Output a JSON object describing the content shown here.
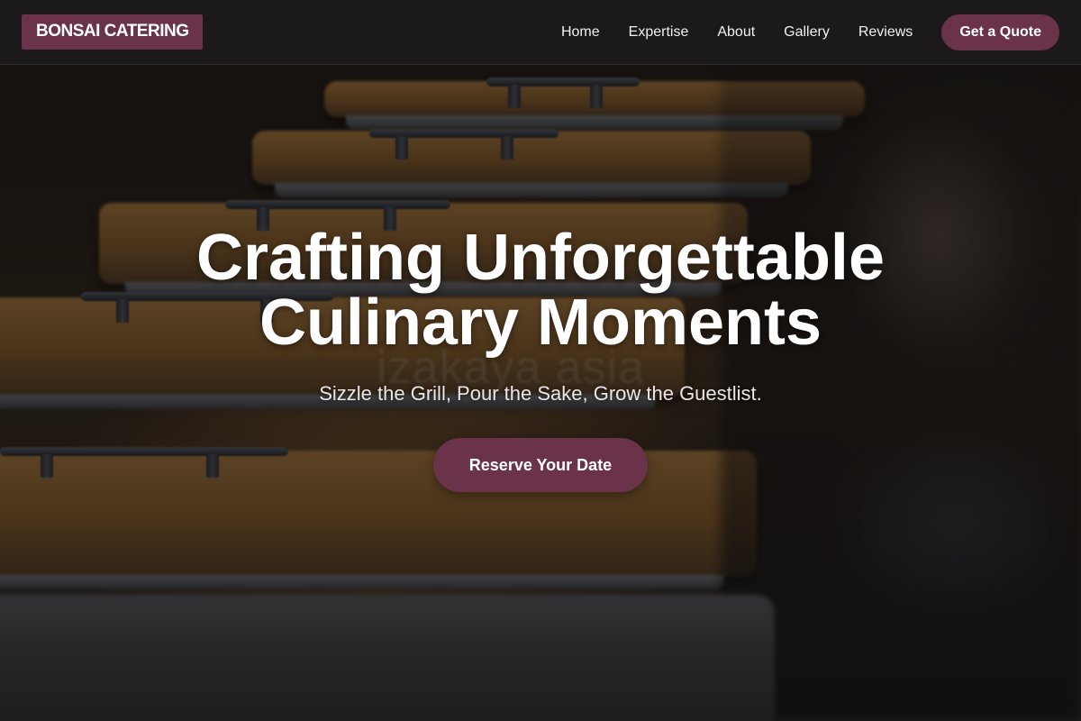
{
  "brand": {
    "logo_text": "BONSAI CATERING",
    "accent_color": "#6b3349"
  },
  "nav": {
    "items": [
      {
        "label": "Home"
      },
      {
        "label": "Expertise"
      },
      {
        "label": "About"
      },
      {
        "label": "Gallery"
      },
      {
        "label": "Reviews"
      }
    ],
    "cta_label": "Get a Quote"
  },
  "hero": {
    "title": "Crafting Unforgettable Culinary Moments",
    "subtitle": "Sizzle the Grill, Pour the Sake, Grow the Guestlist.",
    "cta_label": "Reserve Your Date",
    "background_watermark": "izakaya asia"
  }
}
